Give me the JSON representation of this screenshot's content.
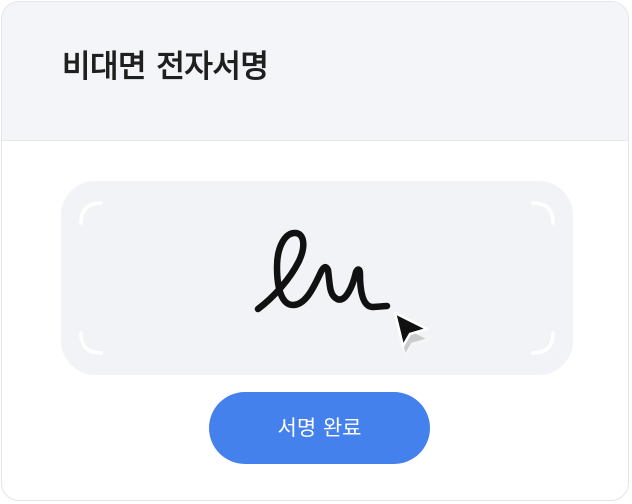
{
  "header": {
    "title": "비대면 전자서명"
  },
  "signature_pad": {
    "corner_icon": "corner-bracket",
    "signature_icon": "handwritten-signature",
    "cursor_icon": "mouse-pointer-arrow"
  },
  "actions": {
    "complete_label": "서명 완료"
  },
  "colors": {
    "accent": "#4481ed",
    "header_bg": "#f3f5f8",
    "pad_bg": "#f2f3f6",
    "ink": "#111111"
  }
}
